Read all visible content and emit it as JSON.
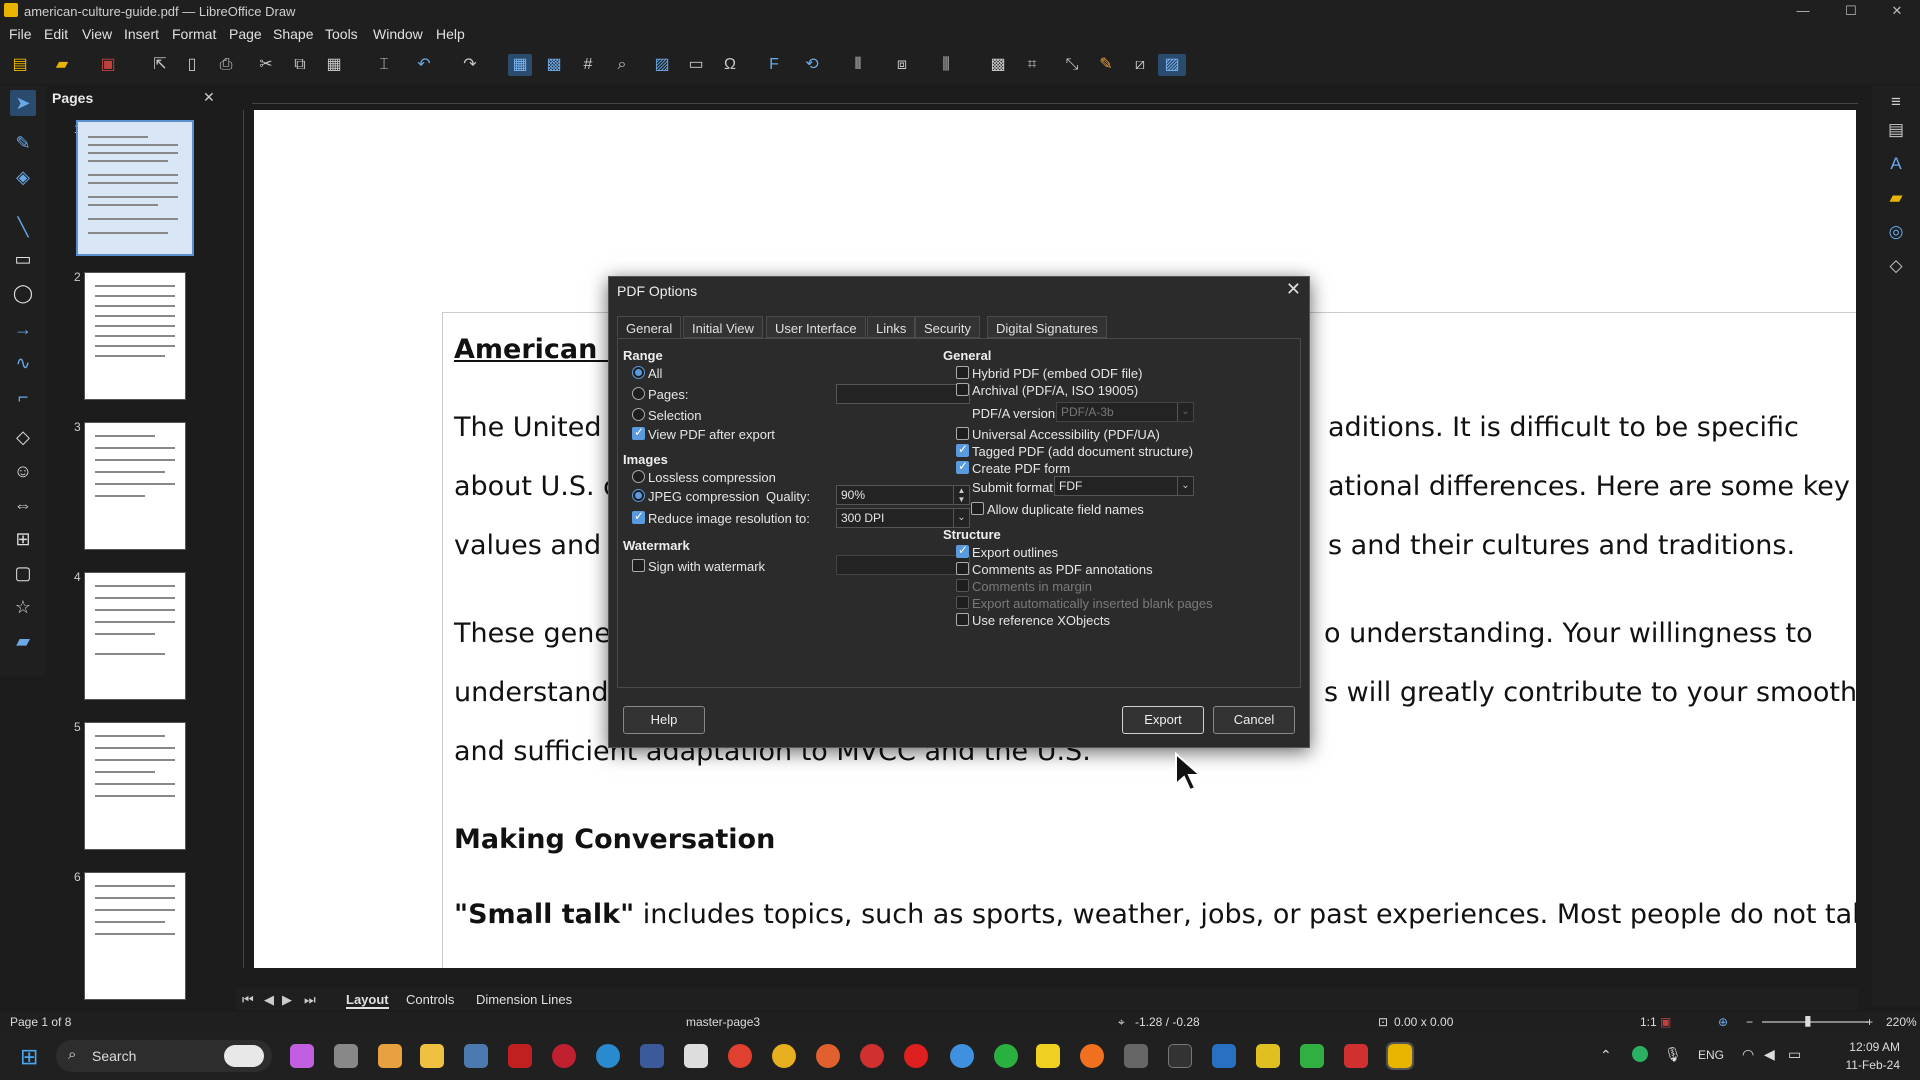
{
  "window": {
    "title": "american-culture-guide.pdf — LibreOffice Draw",
    "min": "—",
    "max": "☐",
    "close": "✕"
  },
  "menu": [
    "File",
    "Edit",
    "View",
    "Insert",
    "Format",
    "Page",
    "Shape",
    "Tools",
    "Window",
    "Help"
  ],
  "sidebar_pages": {
    "title": "Pages",
    "close": "✕",
    "page_numbers": [
      "1",
      "2",
      "3",
      "4",
      "5",
      "6"
    ]
  },
  "document": {
    "heading": "American C",
    "para1": [
      "The United S",
      "about U.S. c",
      "values and g"
    ],
    "para1_right": [
      "aditions. It is difficult to be specific",
      "ational differences. Here are some key",
      "s and their cultures and traditions."
    ],
    "para2": [
      "These gener",
      "understand"
    ],
    "para2_right": [
      "o understanding. Your willingness to",
      "s will greatly contribute to your smooth"
    ],
    "para2_last": "and sufficient adaptation to MVCC and the U.S.",
    "section": "Making Conversation",
    "small_talk_bold": "\"Small talk\"",
    "small_talk_rest": " includes topics, such as sports, weather, jobs, or past experiences. Most people do not talk"
  },
  "dialog": {
    "title": "PDF Options",
    "close": "✕",
    "tabs": [
      "General",
      "Initial View",
      "User Interface",
      "Links",
      "Security",
      "Digital Signatures"
    ],
    "range": {
      "title": "Range",
      "all": "All",
      "pages": "Pages:",
      "pages_value": "",
      "selection": "Selection",
      "view_pdf": "View PDF after export"
    },
    "images": {
      "title": "Images",
      "lossless": "Lossless compression",
      "jpeg": "JPEG compression",
      "quality_label": "Quality:",
      "quality": "90%",
      "reduce": "Reduce image resolution to:",
      "resolution": "300 DPI"
    },
    "watermark": {
      "title": "Watermark",
      "sign": "Sign with watermark",
      "value": ""
    },
    "general": {
      "title": "General",
      "hybrid": "Hybrid PDF (embed ODF file)",
      "archival": "Archival (PDF/A, ISO 19005)",
      "pdfa_label": "PDF/A version:",
      "pdfa_value": "PDF/A-3b",
      "ua": "Universal Accessibility (PDF/UA)",
      "tagged": "Tagged PDF (add document structure)",
      "form": "Create PDF form",
      "submit_label": "Submit format:",
      "submit_value": "FDF",
      "dup": "Allow duplicate field names"
    },
    "structure": {
      "title": "Structure",
      "outlines": "Export outlines",
      "comments": "Comments as PDF annotations",
      "margin": "Comments in margin",
      "blank": "Export automatically inserted blank pages",
      "xobjects": "Use reference XObjects"
    },
    "buttons": {
      "help": "Help",
      "export": "Export",
      "cancel": "Cancel"
    }
  },
  "bottom_tabs": [
    "Layout",
    "Controls",
    "Dimension Lines"
  ],
  "status": {
    "page": "Page 1 of 8",
    "master": "master-page3",
    "position": "-1.28 / -0.28",
    "size": "0.00 x 0.00",
    "scale": "1:1",
    "zoom": "220%"
  },
  "taskbar": {
    "search": "Search",
    "lang": "ENG",
    "time": "12:09 AM",
    "date": "11-Feb-24"
  },
  "colors": {
    "accent": "#5a9be0",
    "toolbar_bg": "#1f1f1f",
    "page_bg": "#ffffff"
  }
}
